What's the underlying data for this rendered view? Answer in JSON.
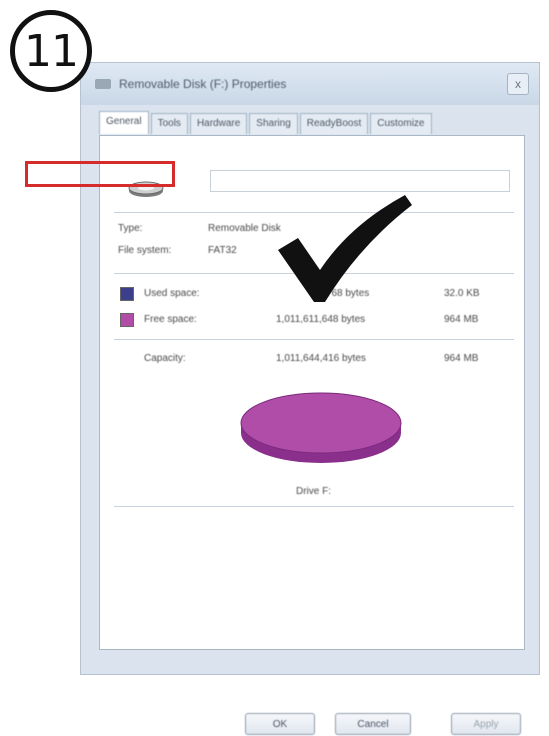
{
  "step": {
    "number": "11"
  },
  "window": {
    "title": "Removable Disk (F:) Properties",
    "close_glyph": "x"
  },
  "tabs": [
    {
      "label": "General",
      "active": true
    },
    {
      "label": "Tools"
    },
    {
      "label": "Hardware"
    },
    {
      "label": "Sharing"
    },
    {
      "label": "ReadyBoost"
    },
    {
      "label": "Customize"
    }
  ],
  "general": {
    "name_value": "",
    "type_label": "Type:",
    "type_value": "Removable Disk",
    "filesystem_label": "File system:",
    "filesystem_value": "FAT32",
    "used_label": "Used space:",
    "used_bytes": "32,768 bytes",
    "used_size": "32.0 KB",
    "free_label": "Free space:",
    "free_bytes": "1,011,611,648 bytes",
    "free_size": "964 MB",
    "capacity_label": "Capacity:",
    "capacity_bytes": "1,011,644,416 bytes",
    "capacity_size": "964 MB",
    "drive_caption": "Drive F:"
  },
  "buttons": {
    "ok": "OK",
    "cancel": "Cancel",
    "apply": "Apply"
  },
  "colors": {
    "used": "#3b3f8c",
    "free": "#b04da8",
    "highlight": "#d52b2b",
    "checkmark": "#111111"
  },
  "icons": {
    "drive": "removable-drive-icon",
    "check": "checkmark-icon"
  }
}
